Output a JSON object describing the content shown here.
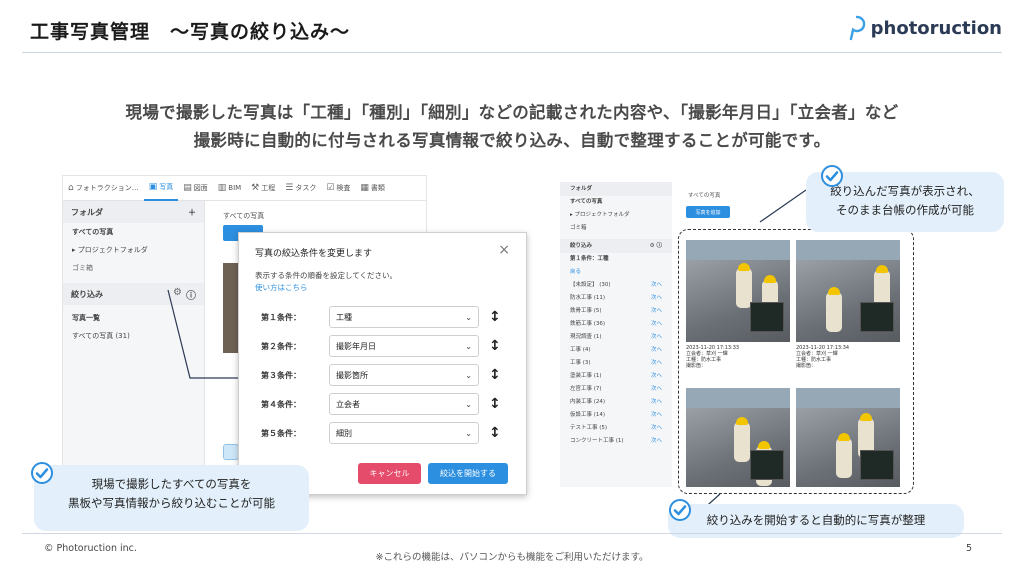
{
  "slide": {
    "title": "工事写真管理　～写真の絞り込み～",
    "brand": "photoruction",
    "lead_line1": "現場で撮影した写真は「工種」「種別」「細別」などの記載された内容や、「撮影年月日」「立会者」など",
    "lead_line2": "撮影時に自動的に付与される写真情報で絞り込み、自動で整理することが可能です。",
    "copyright": "© Photoruction inc.",
    "footnote": "※これらの機能は、パソコンからも機能をご利用いただけます。",
    "page_number": "5"
  },
  "left_app": {
    "toolbar": [
      {
        "icon": "home-icon",
        "glyph": "⌂",
        "label": "フォトラクション…"
      },
      {
        "icon": "photo-icon",
        "glyph": "▣",
        "label": "写真",
        "active": true
      },
      {
        "icon": "drawing-icon",
        "glyph": "▤",
        "label": "図面"
      },
      {
        "icon": "bim-icon",
        "glyph": "▥",
        "label": "BIM"
      },
      {
        "icon": "construction-icon",
        "glyph": "⚒",
        "label": "工程"
      },
      {
        "icon": "task-icon",
        "glyph": "☰",
        "label": "タスク"
      },
      {
        "icon": "inspection-icon",
        "glyph": "☑",
        "label": "検査"
      },
      {
        "icon": "document-icon",
        "glyph": "▦",
        "label": "書類"
      }
    ],
    "folder_header": "フォルダ",
    "all_photos": "すべての写真",
    "project_folder": "プロジェクトフォルダ",
    "trash": "ゴミ箱",
    "filter_header": "絞り込み",
    "photo_list": "写真一覧",
    "all_photos_count": "すべての写真 (31)",
    "main_crumb": "すべての写真"
  },
  "dialog": {
    "title": "写真の絞込条件を変更します",
    "close": "×",
    "description": "表示する条件の順番を設定してください。",
    "help_link": "使い方はこちら",
    "conditions": [
      {
        "label": "第１条件：",
        "value": "工種"
      },
      {
        "label": "第２条件：",
        "value": "撮影年月日"
      },
      {
        "label": "第３条件：",
        "value": "撮影箇所"
      },
      {
        "label": "第４条件：",
        "value": "立会者"
      },
      {
        "label": "第５条件：",
        "value": "細別"
      }
    ],
    "cancel_label": "キャンセル",
    "start_label": "絞込を開始する"
  },
  "callouts": {
    "left_line1": "現場で撮影したすべての写真を",
    "left_line2": "黒板や写真情報から絞り込むことが可能",
    "top_right_line1": "絞り込んだ写真が表示され、",
    "top_right_line2": "そのまま台帳の作成が可能",
    "bottom_right": "絞り込みを開始すると自動的に写真が整理"
  },
  "right_app": {
    "folder_header": "フォルダ",
    "all_photos": "すべての写真",
    "project_folder": "プロジェクトフォルダ",
    "trash": "ゴミ箱",
    "filter_header": "絞り込み",
    "condition1": "第１条件：工種",
    "back": "戻る",
    "next": "次へ",
    "categories": [
      "【未設定】 (30)",
      "防水工事 (11)",
      "鉄骨工事 (5)",
      "鉄筋工事 (36)",
      "現況調査 (1)",
      "工事 (4)",
      "工事 (3)",
      "塗装工事 (1)",
      "左官工事 (7)",
      "内装工事 (24)",
      "仮設工事 (14)",
      "テスト工事 (5)",
      "コンクリート工事 (1)"
    ],
    "crumb": "すべての写真",
    "add_button": "写真を追加",
    "photos": [
      {
        "date": "2023-11-20 17:13:33",
        "line2": "立会者：草刈 一輝",
        "line3": "工種：防水工事",
        "line4": "撮影箇：",
        "style": "a"
      },
      {
        "date": "2023-11-20 17:13:34",
        "line2": "立会者：草刈 一輝",
        "line3": "工種：防水工事",
        "line4": "撮影箇：",
        "style": "b"
      },
      {
        "date": "",
        "line2": "",
        "line3": "",
        "line4": "",
        "style": "c"
      },
      {
        "date": "",
        "line2": "",
        "line3": "",
        "line4": "",
        "style": "d"
      }
    ]
  },
  "colors": {
    "accent": "#2d8fe0",
    "cancel": "#e54b6a",
    "callout_bg": "#e3f0fb",
    "helmet": "#f2c500"
  }
}
